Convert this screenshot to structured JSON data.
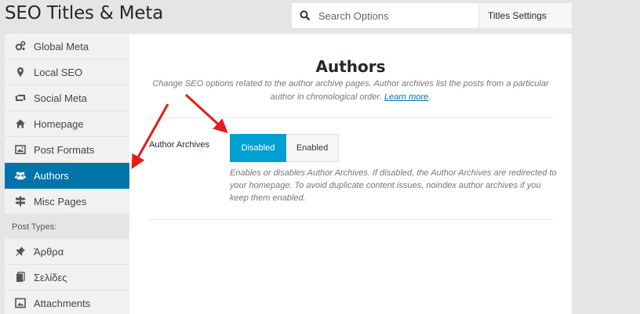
{
  "page_title": "SEO Titles & Meta",
  "search": {
    "placeholder": "Search Options"
  },
  "settings_select": {
    "value": "Titles Settings"
  },
  "sidebar": {
    "items": [
      {
        "label": "Global Meta",
        "icon": "cogs-icon"
      },
      {
        "label": "Local SEO",
        "icon": "map-pin-icon"
      },
      {
        "label": "Social Meta",
        "icon": "retweet-icon"
      },
      {
        "label": "Homepage",
        "icon": "home-icon"
      },
      {
        "label": "Post Formats",
        "icon": "image-icon"
      },
      {
        "label": "Authors",
        "icon": "users-icon",
        "active": true
      },
      {
        "label": "Misc Pages",
        "icon": "signpost-icon"
      }
    ],
    "group_label": "Post Types:",
    "post_types": [
      {
        "label": "Άρθρα",
        "icon": "pin-icon"
      },
      {
        "label": "Σελίδες",
        "icon": "pages-icon"
      },
      {
        "label": "Attachments",
        "icon": "attachment-icon"
      }
    ]
  },
  "main": {
    "title": "Authors",
    "description": "Change SEO options related to the author archive pages. Author archives list the posts from a particular author in chronological order.",
    "learn_more": "Learn more",
    "description_end": ".",
    "field": {
      "label": "Author Archives",
      "options": [
        "Disabled",
        "Enabled"
      ],
      "selected": "Disabled",
      "help": "Enables or disables Author Archives. If disabled, the Author Archives are redirected to your homepage. To avoid duplicate content issues, noindex author archives if you keep them enabled."
    }
  },
  "colors": {
    "active_nav": "#0073aa",
    "toggle_on": "#00a0d2",
    "annotation_arrow": "#e8191b"
  }
}
